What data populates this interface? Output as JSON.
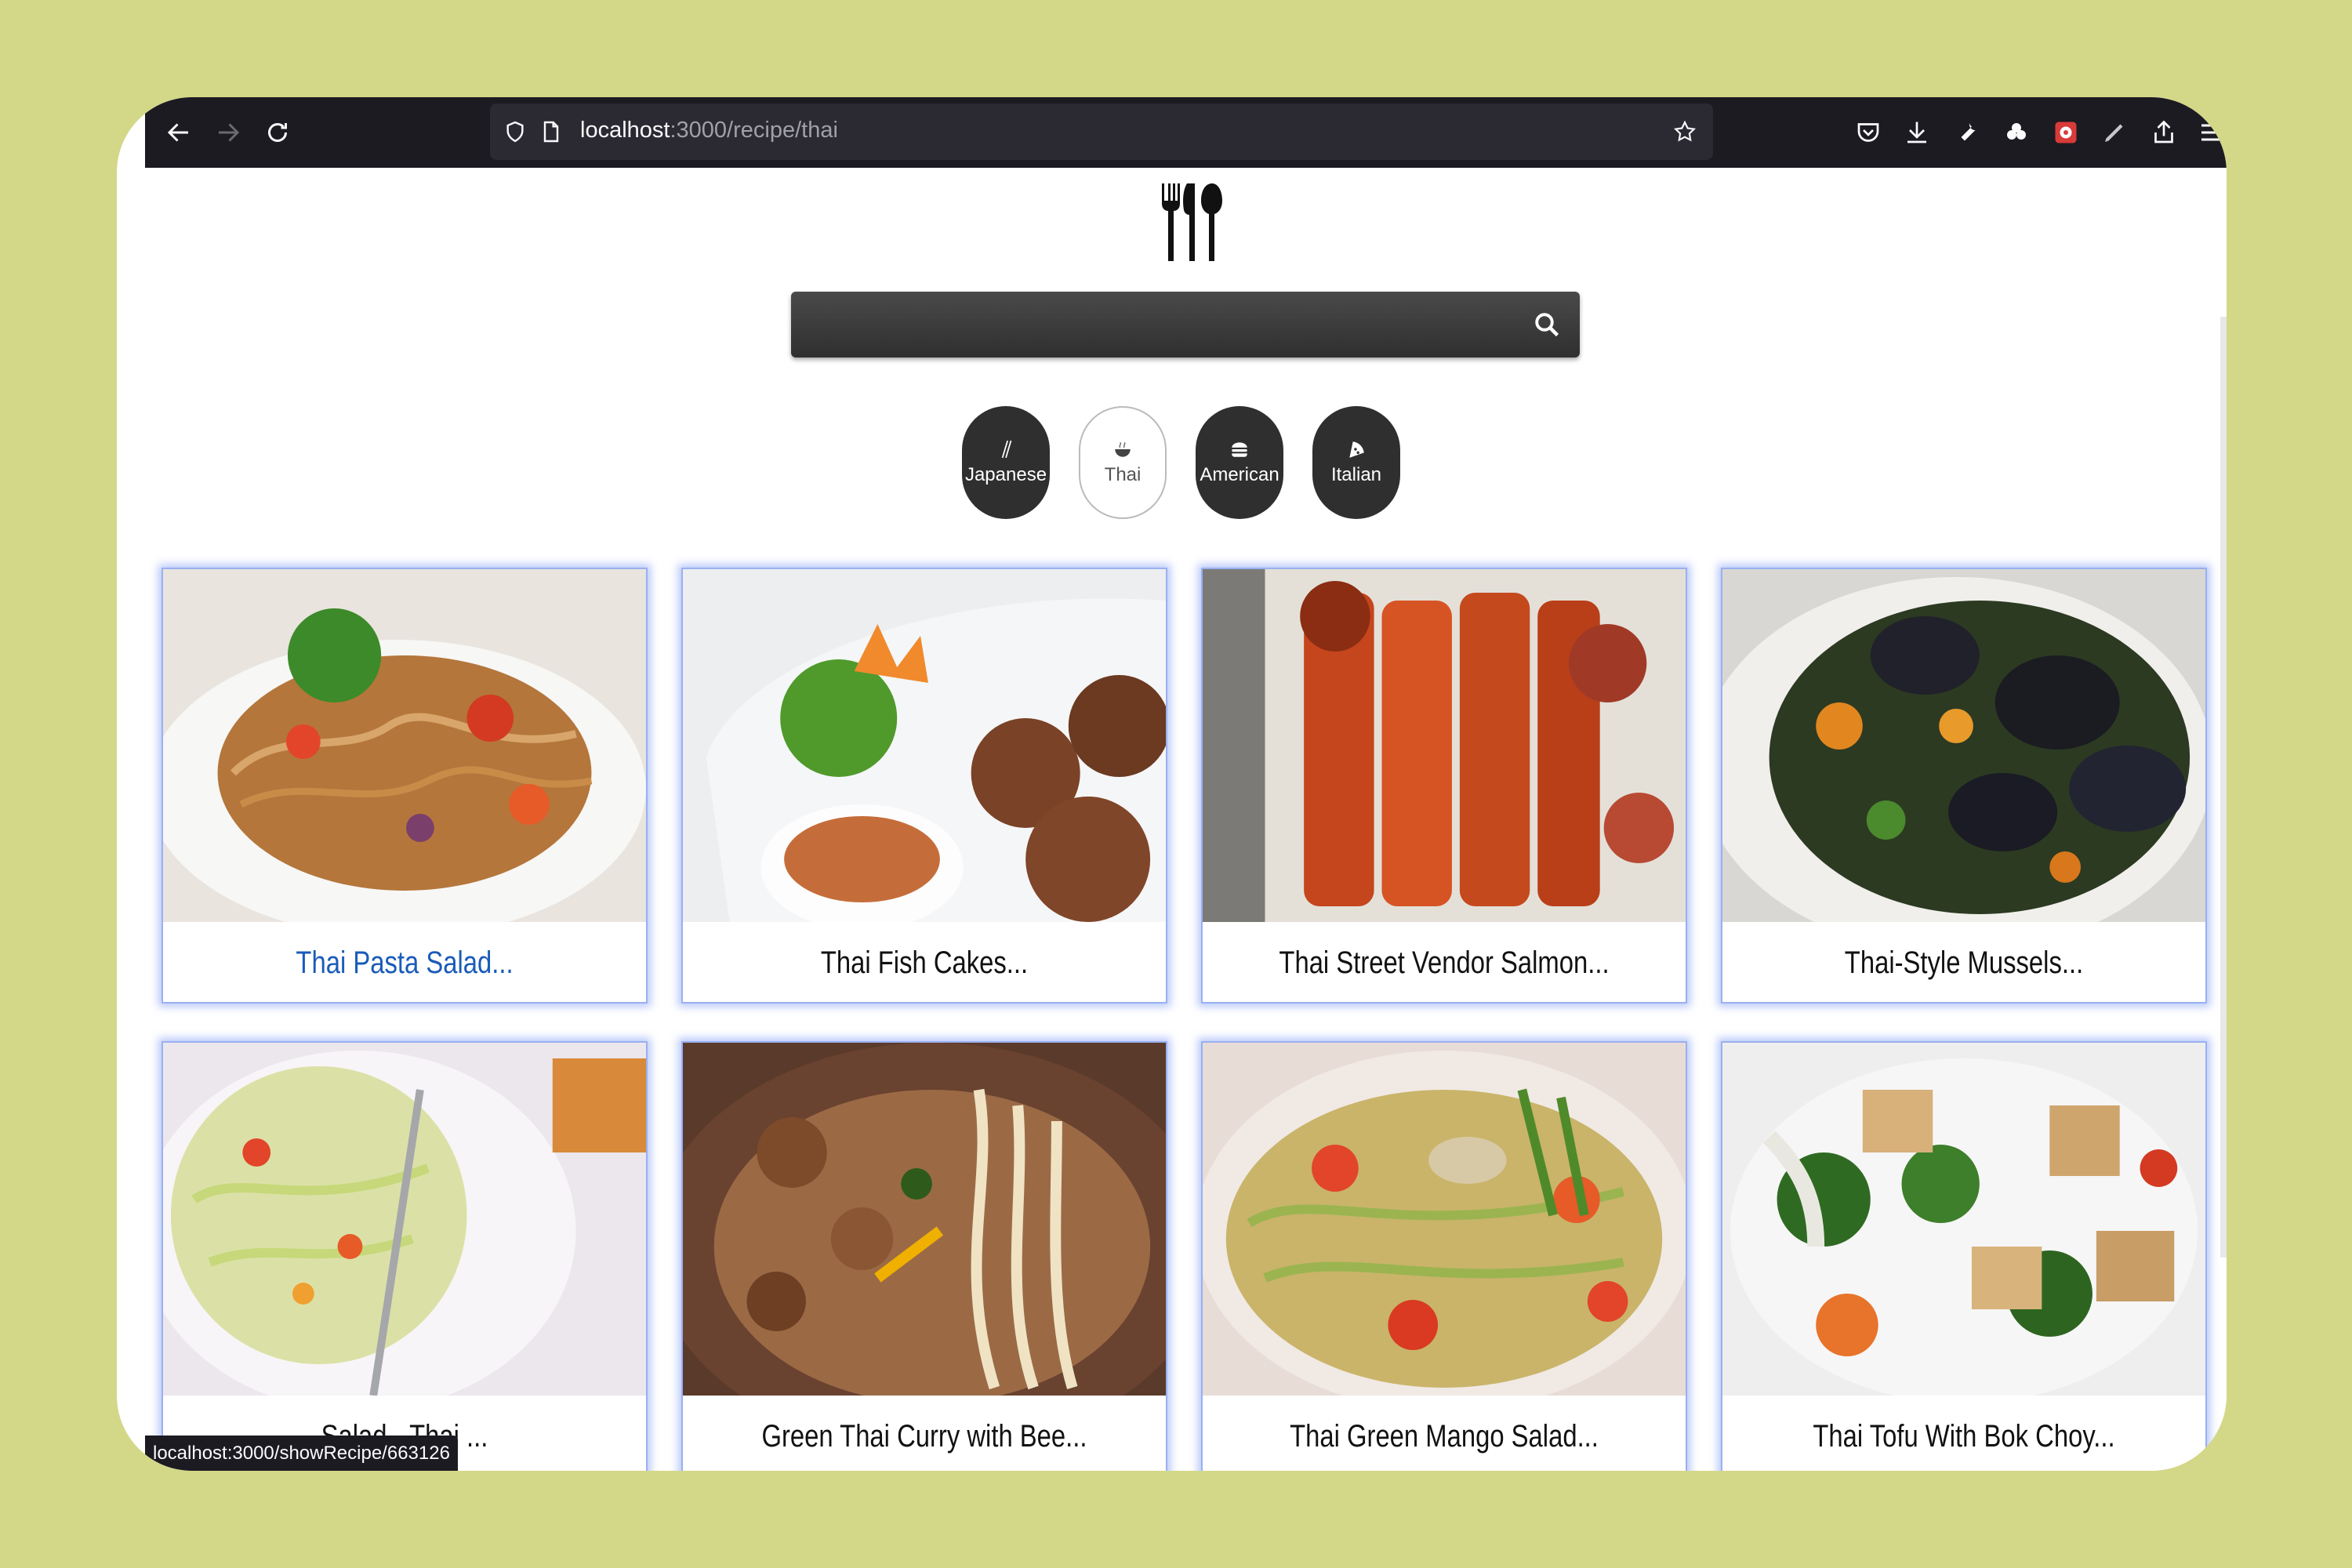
{
  "browser": {
    "url_host": "localhost",
    "url_rest": ":3000/recipe/thai",
    "status_url": "localhost:3000/showRecipe/663126"
  },
  "search": {
    "placeholder": "",
    "value": ""
  },
  "cuisines": [
    {
      "label": "Japanese",
      "icon": "chopsticks-icon",
      "active": false
    },
    {
      "label": "Thai",
      "icon": "bowl-icon",
      "active": true
    },
    {
      "label": "American",
      "icon": "hamburger-icon",
      "active": false
    },
    {
      "label": "Italian",
      "icon": "pizza-icon",
      "active": false
    }
  ],
  "recipes": [
    {
      "title": "Thai Pasta Salad...",
      "hovered": true
    },
    {
      "title": "Thai Fish Cakes..."
    },
    {
      "title": "Thai Street Vendor Salmon..."
    },
    {
      "title": "Thai-Style Mussels..."
    },
    {
      "title": "Salad - Thai ..."
    },
    {
      "title": "Green Thai Curry with Bee..."
    },
    {
      "title": "Thai Green Mango Salad..."
    },
    {
      "title": "Thai Tofu With Bok Choy..."
    }
  ],
  "colors": {
    "page_bg": "#d3d888",
    "toolbar_bg": "#1c1b22",
    "card_glow": "#5f82f5",
    "link_blue": "#1a5bb8"
  }
}
